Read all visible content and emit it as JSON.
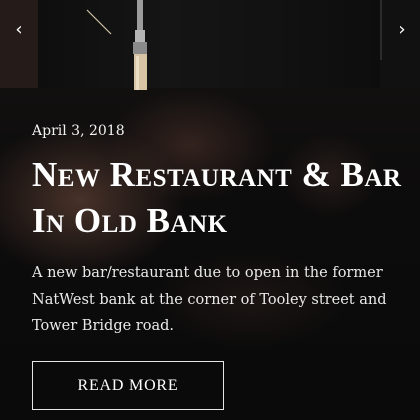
{
  "slider": {
    "prev_icon": "‹",
    "next_icon": "›"
  },
  "post": {
    "date": "April 3, 2018",
    "title": "New Restaurant & Bar In Old Bank",
    "excerpt": "A new bar/restaurant due to open in the former NatWest bank at the corner of Tooley street and Tower Bridge road.",
    "read_more_label": "READ MORE"
  },
  "colors": {
    "text": "#ffffff",
    "background": "#0b0b0b",
    "button_border": "#e6e6e6"
  }
}
